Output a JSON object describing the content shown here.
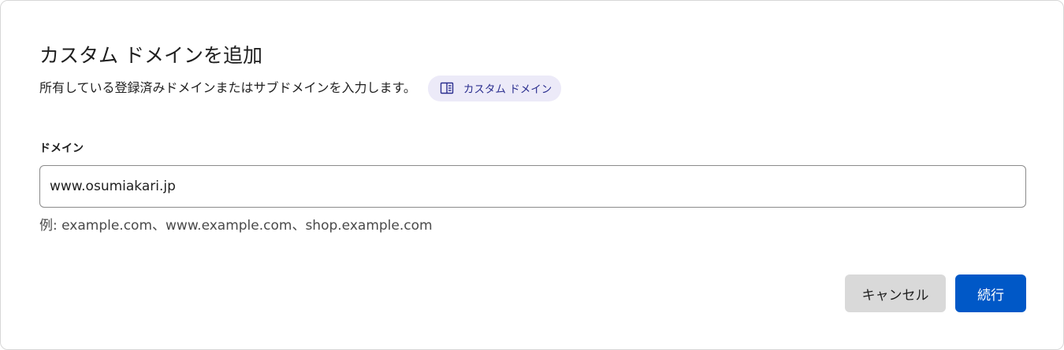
{
  "dialog": {
    "title": "カスタム ドメインを追加",
    "subtitle": "所有している登録済みドメインまたはサブドメインを入力します。",
    "doc_chip": {
      "icon": "book-icon",
      "label": "カスタム ドメイン"
    }
  },
  "form": {
    "domain_label": "ドメイン",
    "domain_value": "www.osumiakari.jp",
    "hint": "例: example.com、www.example.com、shop.example.com"
  },
  "actions": {
    "cancel_label": "キャンセル",
    "continue_label": "続行"
  },
  "colors": {
    "primary": "#0058c7",
    "secondary_button": "#d9d9d9",
    "chip_background": "#eceaf8",
    "chip_text": "#2b2f8f"
  }
}
